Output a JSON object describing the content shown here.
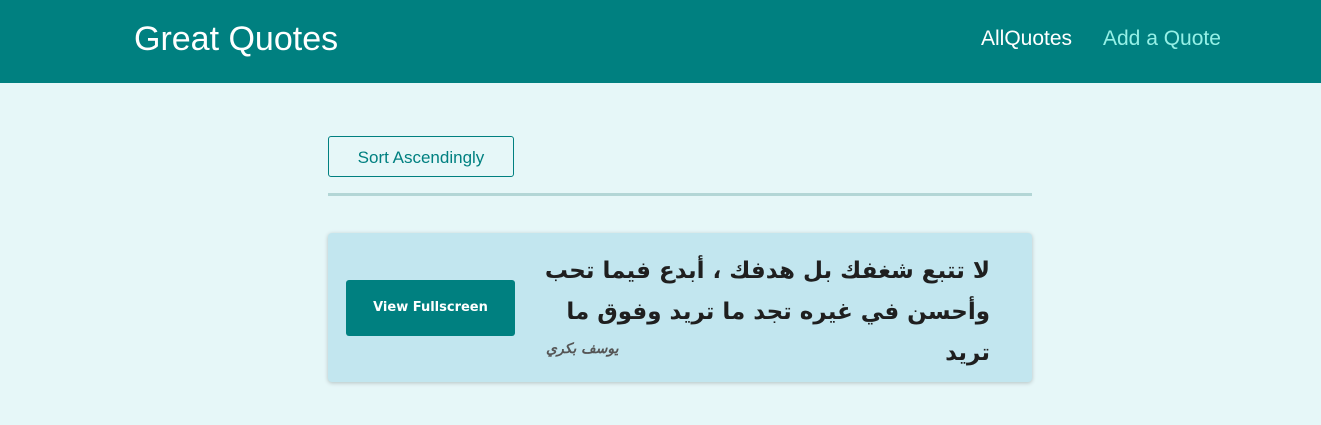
{
  "header": {
    "logo": "Great Quotes",
    "nav": {
      "all_quotes": "AllQuotes",
      "add_quote": "Add a Quote"
    }
  },
  "toolbar": {
    "sort_label": "Sort Ascendingly"
  },
  "quotes": [
    {
      "text": "لا تتبع شغفك بل هدفك ، أبدع فيما تحب وأحسن في غيره تجد ما تريد وفوق ما تريد",
      "author": "يوسف بكري",
      "view_label": "View Fullscreen"
    }
  ],
  "colors": {
    "header": "#008080",
    "background": "#e6f7f8",
    "card": "#c2e6ef",
    "accent": "#008080",
    "active_link": "#95f0e6"
  }
}
